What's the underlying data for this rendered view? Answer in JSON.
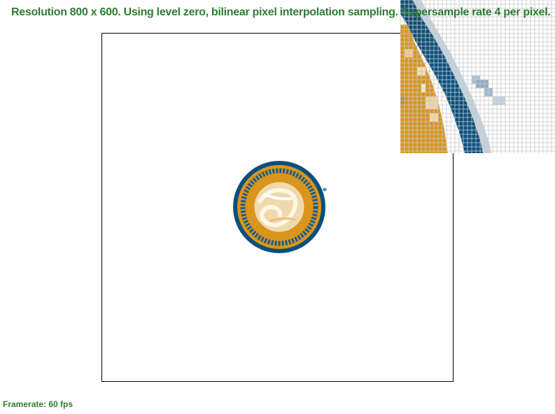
{
  "header": {
    "status_text": "Resolution 800 x 600. Using level zero, bilinear pixel interpolation sampling. Supersample rate 4 per pixel."
  },
  "footer": {
    "framerate_text": "Framerate: 60 fps"
  },
  "colors": {
    "status_text": "#2e7d32",
    "logo_blue": "#0b4f7c",
    "logo_gold": "#d9951e",
    "logo_cream": "#f5e6c8",
    "canvas_border": "#000000",
    "zoom_grid": "#c8c8c8"
  }
}
